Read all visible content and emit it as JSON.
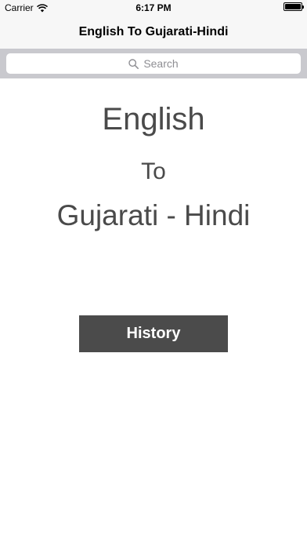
{
  "status_bar": {
    "carrier": "Carrier",
    "time": "6:17 PM",
    "battery_level": 1.0
  },
  "nav_bar": {
    "title": "English To Gujarati-Hindi"
  },
  "search": {
    "placeholder": "Search"
  },
  "main": {
    "line1": "English",
    "line2": "To",
    "line3": "Gujarati - Hindi",
    "history_button_label": "History"
  },
  "colors": {
    "bar_background": "#f7f7f7",
    "search_bar_background": "#c9c9ce",
    "heading_text": "#4a4a4a",
    "button_background": "#4b4b4b",
    "button_text": "#ffffff"
  }
}
